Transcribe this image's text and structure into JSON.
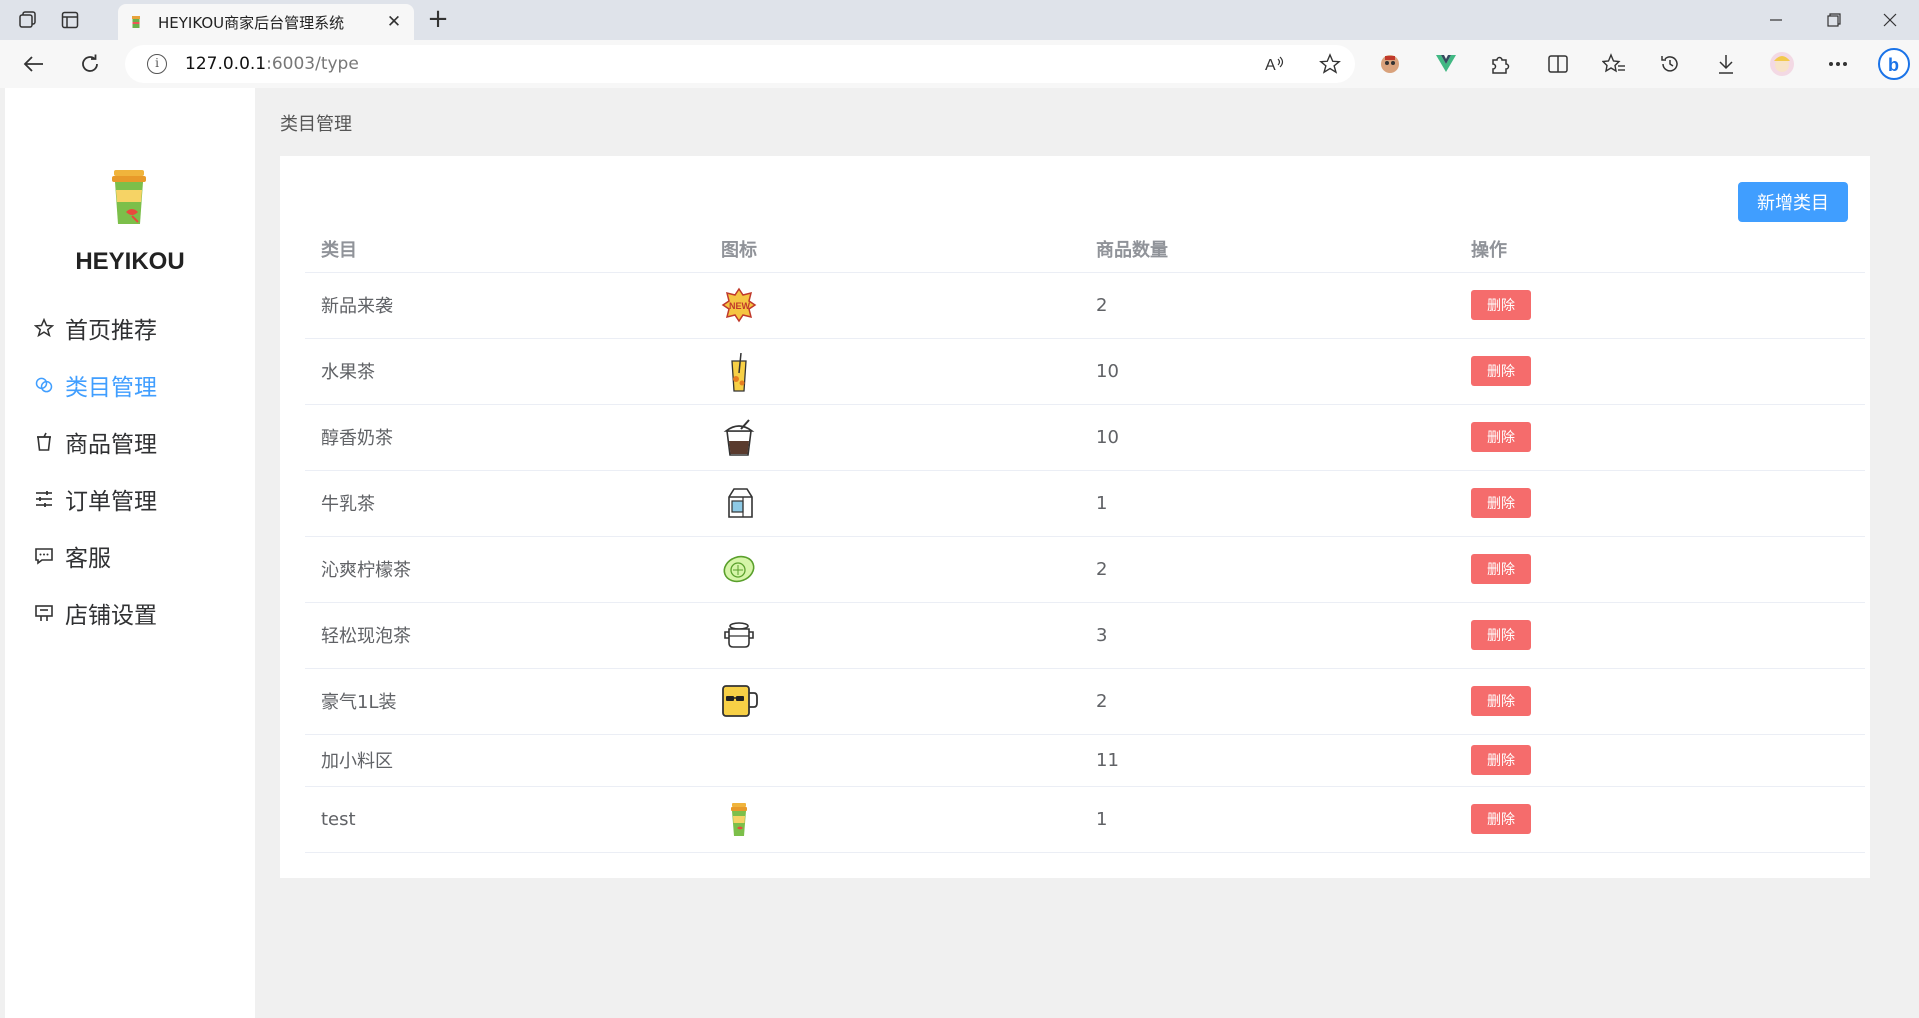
{
  "browser": {
    "tab_title": "HEYIKOU商家后台管理系统",
    "url_host": "127.0.0.1",
    "url_rest": ":6003/type"
  },
  "app": {
    "logo_text": "HEYIKOU",
    "menu": [
      {
        "label": "首页推荐",
        "icon": "star-icon"
      },
      {
        "label": "类目管理",
        "icon": "link-icon",
        "active": true
      },
      {
        "label": "商品管理",
        "icon": "cup-icon"
      },
      {
        "label": "订单管理",
        "icon": "sliders-icon"
      },
      {
        "label": "客服",
        "icon": "chat-icon"
      },
      {
        "label": "店铺设置",
        "icon": "shop-icon"
      }
    ],
    "breadcrumb": "类目管理",
    "add_button": "新增类目",
    "table": {
      "headers": [
        "类目",
        "图标",
        "商品数量",
        "操作"
      ],
      "rows": [
        {
          "name": "新品来袭",
          "icon": "new-badge-icon",
          "count": "2",
          "action": "删除"
        },
        {
          "name": "水果茶",
          "icon": "fruit-tea-icon",
          "count": "10",
          "action": "删除"
        },
        {
          "name": "醇香奶茶",
          "icon": "milk-tea-icon",
          "count": "10",
          "action": "删除"
        },
        {
          "name": "牛乳茶",
          "icon": "milk-carton-icon",
          "count": "1",
          "action": "删除"
        },
        {
          "name": "沁爽柠檬茶",
          "icon": "lemon-icon",
          "count": "2",
          "action": "删除"
        },
        {
          "name": "轻松现泡茶",
          "icon": "teapot-icon",
          "count": "3",
          "action": "删除"
        },
        {
          "name": "豪气1L装",
          "icon": "big-mug-icon",
          "count": "2",
          "action": "删除"
        },
        {
          "name": "加小料区",
          "icon": "",
          "count": "11",
          "action": "删除"
        },
        {
          "name": "test",
          "icon": "cup-logo-icon",
          "count": "1",
          "action": "删除"
        }
      ]
    }
  }
}
